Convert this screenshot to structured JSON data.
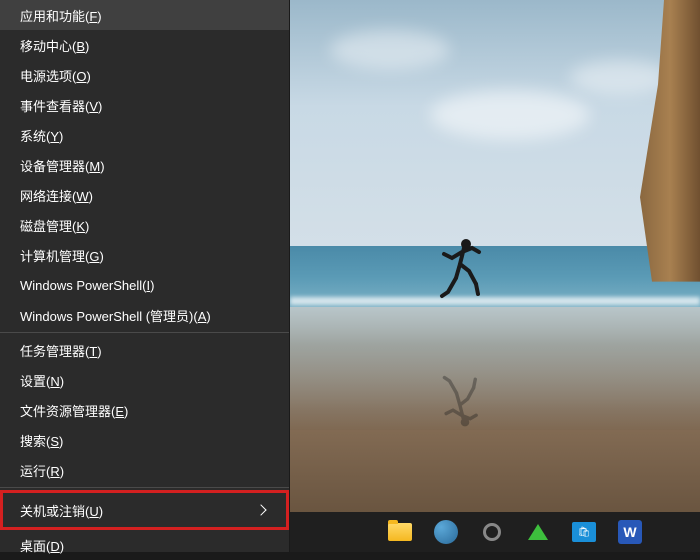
{
  "menu": {
    "groups": [
      {
        "items": [
          {
            "label": "应用和功能(F)",
            "name": "menu-apps-features"
          },
          {
            "label": "移动中心(B)",
            "name": "menu-mobility-center"
          },
          {
            "label": "电源选项(O)",
            "name": "menu-power-options"
          },
          {
            "label": "事件查看器(V)",
            "name": "menu-event-viewer"
          },
          {
            "label": "系统(Y)",
            "name": "menu-system"
          },
          {
            "label": "设备管理器(M)",
            "name": "menu-device-manager"
          },
          {
            "label": "网络连接(W)",
            "name": "menu-network-connections"
          },
          {
            "label": "磁盘管理(K)",
            "name": "menu-disk-management"
          },
          {
            "label": "计算机管理(G)",
            "name": "menu-computer-management"
          },
          {
            "label": "Windows PowerShell(I)",
            "name": "menu-powershell"
          },
          {
            "label": "Windows PowerShell (管理员)(A)",
            "name": "menu-powershell-admin"
          }
        ]
      },
      {
        "items": [
          {
            "label": "任务管理器(T)",
            "name": "menu-task-manager"
          },
          {
            "label": "设置(N)",
            "name": "menu-settings"
          },
          {
            "label": "文件资源管理器(E)",
            "name": "menu-file-explorer"
          },
          {
            "label": "搜索(S)",
            "name": "menu-search"
          },
          {
            "label": "运行(R)",
            "name": "menu-run"
          }
        ]
      },
      {
        "items": [
          {
            "label": "关机或注销(U)",
            "name": "menu-shutdown-signout",
            "submenu": true,
            "highlighted": true
          },
          {
            "label": "桌面(D)",
            "name": "menu-desktop"
          }
        ]
      }
    ]
  },
  "taskbar": {
    "icons": [
      {
        "name": "taskbar-file-explorer",
        "type": "folder"
      },
      {
        "name": "taskbar-app-blue",
        "type": "circle-blue"
      },
      {
        "name": "taskbar-settings",
        "type": "settings"
      },
      {
        "name": "taskbar-upload",
        "type": "arrow-up"
      },
      {
        "name": "taskbar-store",
        "type": "store"
      },
      {
        "name": "taskbar-word",
        "type": "word",
        "letter": "W"
      }
    ]
  }
}
